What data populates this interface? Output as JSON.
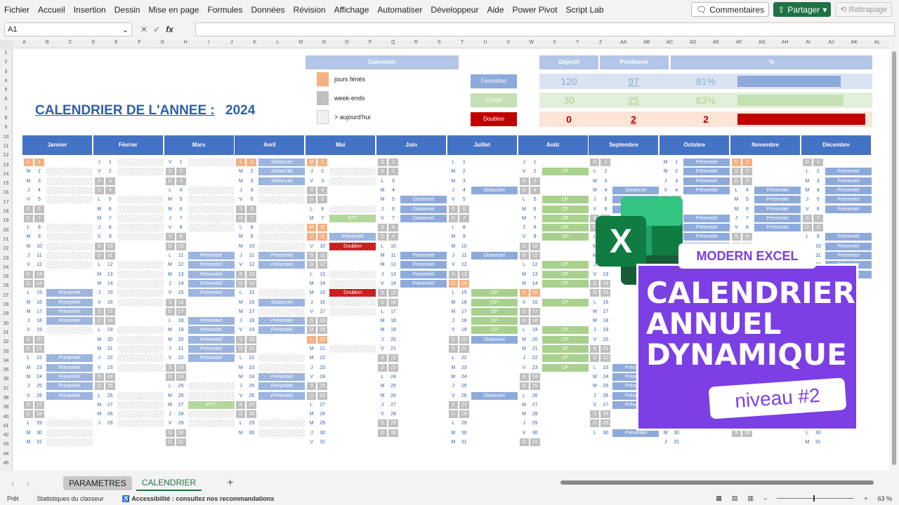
{
  "menu": [
    "Fichier",
    "Accueil",
    "Insertion",
    "Dessin",
    "Mise en page",
    "Formules",
    "Données",
    "Révision",
    "Affichage",
    "Automatiser",
    "Développeur",
    "Aide",
    "Power Pivot",
    "Script Lab"
  ],
  "ribbon_buttons": {
    "comments": "Commentaires",
    "share": "Partager",
    "restore": "Rattrapage"
  },
  "formula_bar": {
    "name_box": "A1",
    "fx": "fx",
    "cancel": "✕",
    "confirm": "✓"
  },
  "columns": [
    "A",
    "B",
    "C",
    "D",
    "E",
    "F",
    "G",
    "H",
    "I",
    "J",
    "K",
    "L",
    "M",
    "N",
    "O",
    "P",
    "Q",
    "R",
    "S",
    "T",
    "U",
    "V",
    "W",
    "X",
    "Y",
    "Z",
    "AA",
    "AB",
    "AC",
    "AD",
    "AE",
    "AF",
    "AG",
    "AH",
    "AI",
    "AJ",
    "AK",
    "AL"
  ],
  "rows_count": 45,
  "title": {
    "prefix": "CALENDRIER DE L'ANNEE :",
    "year": "2024"
  },
  "legend": {
    "header": "Calendrier",
    "items": [
      {
        "label": "jours fériés",
        "type": "hol"
      },
      {
        "label": "week-ends",
        "type": "we"
      },
      {
        "label": "> aujourd'hui",
        "type": "past"
      }
    ]
  },
  "stats": {
    "headers": {
      "objectif": "Objectif",
      "positionne": "Positionné",
      "pct": "%"
    },
    "rows": [
      {
        "label": "Formation",
        "objectif": "120",
        "positionne": "97",
        "pct": "81%",
        "fill": 0.81,
        "color": "#8eaadb",
        "bg": "#dae3f3",
        "label_bg": "#8eaadb",
        "val_color": "#8eaadb"
      },
      {
        "label": "Congé",
        "objectif": "30",
        "positionne": "25",
        "pct": "83%",
        "fill": 0.83,
        "color": "#c5e0b4",
        "bg": "#e2efda",
        "label_bg": "#c5e0b4",
        "val_color": "#a9d18e"
      },
      {
        "label": "Doublon",
        "objectif": "0",
        "positionne": "2",
        "pct": "2",
        "fill": 1.0,
        "color": "#c00000",
        "bg": "#fce4d6",
        "label_bg": "#c00000",
        "val_color": "#c00000"
      }
    ]
  },
  "months": [
    {
      "name": "Janvier",
      "first_dow": 0,
      "days": 31,
      "hol": [
        1
      ],
      "events": {
        "15": "Présentiel",
        "16": "Présentiel",
        "17": "Présentiel",
        "18": "Présentiel",
        "22": "Présentiel",
        "23": "Présentiel",
        "24": "Présentiel",
        "25": "Présentiel",
        "26": "Présentiel"
      }
    },
    {
      "name": "Février",
      "first_dow": 3,
      "days": 29,
      "hol": [],
      "events": {}
    },
    {
      "name": "Mars",
      "first_dow": 4,
      "days": 31,
      "hol": [],
      "events": {
        "11": "Présentiel",
        "12": "Présentiel",
        "13": "Présentiel",
        "14": "Présentiel",
        "15": "Présentiel",
        "18": "Présentiel",
        "19": "Présentiel",
        "20": "Présentiel",
        "21": "Présentiel",
        "22": "Présentiel",
        "27": "RTT"
      }
    },
    {
      "name": "Avril",
      "first_dow": 0,
      "days": 30,
      "hol": [
        1
      ],
      "events": {
        "1": "Distanciel",
        "2": "Distanciel",
        "3": "Distanciel",
        "11": "Présentiel",
        "12": "Présentiel",
        "16": "Distanciel",
        "18": "Présentiel",
        "19": "Présentiel",
        "24": "Présentiel",
        "25": "Présentiel",
        "26": "Présentiel"
      }
    },
    {
      "name": "Mai",
      "first_dow": 2,
      "days": 31,
      "hol": [
        1,
        8,
        9,
        20
      ],
      "events": {
        "7": "RTT",
        "9": "Présentiel",
        "10": "Doublon",
        "15": "Doublon"
      }
    },
    {
      "name": "Juin",
      "first_dow": 5,
      "days": 30,
      "hol": [],
      "events": {
        "5": "Distanciel",
        "6": "Distanciel",
        "7": "Distanciel",
        "11": "Présentiel",
        "12": "Présentiel",
        "13": "Présentiel",
        "14": "Présentiel"
      }
    },
    {
      "name": "Juillet",
      "first_dow": 0,
      "days": 31,
      "hol": [
        14
      ],
      "events": {
        "4": "Distanciel",
        "11": "Distanciel",
        "15": "CP",
        "16": "CP",
        "17": "CP",
        "18": "CP",
        "19": "CP",
        "20": "Distanciel",
        "26": "Distanciel"
      }
    },
    {
      "name": "Août",
      "first_dow": 3,
      "days": 31,
      "hol": [
        15
      ],
      "events": {
        "2": "CP",
        "5": "CP",
        "6": "CP",
        "7": "CP",
        "8": "CP",
        "9": "CP",
        "12": "CP",
        "13": "CP",
        "14": "CP",
        "16": "CP",
        "19": "CP",
        "20": "CP",
        "21": "CP",
        "22": "CP",
        "23": "CP"
      }
    },
    {
      "name": "Septembre",
      "first_dow": 6,
      "days": 30,
      "hol": [],
      "events": {
        "4": "Distanciel",
        "5": "Distanciel",
        "6": "Distanciel",
        "23": "Présentiel",
        "24": "Présentiel",
        "25": "Présentiel",
        "26": "Présentiel",
        "27": "Présentiel",
        "30": "Présentiel"
      }
    },
    {
      "name": "Octobre",
      "first_dow": 1,
      "days": 31,
      "hol": [],
      "events": {
        "1": "Présentiel",
        "2": "Présentiel",
        "3": "Présentiel",
        "4": "Présentiel",
        "7": "Présentiel",
        "8": "Présentiel",
        "9": "Présentiel",
        "10": "Présentiel",
        "11": "Présentiel"
      }
    },
    {
      "name": "Novembre",
      "first_dow": 4,
      "days": 30,
      "hol": [
        1,
        11
      ],
      "events": {
        "4": "Présentiel",
        "5": "Présentiel",
        "6": "Présentiel",
        "7": "Présentiel",
        "8": "Présentiel"
      }
    },
    {
      "name": "Décembre",
      "first_dow": 6,
      "days": 31,
      "hol": [
        25
      ],
      "events": {
        "2": "Présentiel",
        "3": "Présentiel",
        "4": "Présentiel",
        "5": "Présentiel",
        "6": "Présentiel",
        "9": "Présentiel",
        "10": "Présentiel",
        "11": "Présentiel",
        "12": "Présentiel",
        "13": "Présentiel"
      }
    }
  ],
  "day_letters": [
    "L",
    "M",
    "M",
    "J",
    "V",
    "S",
    "D"
  ],
  "today": {
    "month_index": 4,
    "day": 22
  },
  "promo": {
    "tag": "MODERN EXCEL",
    "title_lines": [
      "CALENDRIER",
      "ANNUEL",
      "DYNAMIQUE"
    ],
    "level": "niveau #2"
  },
  "tabs": {
    "params": "PARAMETRES",
    "active": "CALENDRIER",
    "add": "+"
  },
  "status": {
    "ready": "Prêt",
    "stats": "Statistiques du classeur",
    "accessibility": "Accessibilité : consultez nos recommandations",
    "zoom": "63 %"
  },
  "colors": {
    "accent": "#4472c4",
    "excel_green": "#1e7145",
    "promo_purple": "#7b3fe4"
  }
}
